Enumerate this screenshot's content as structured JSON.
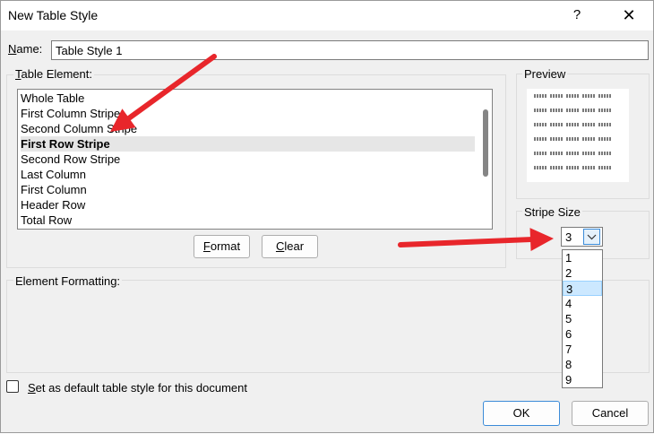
{
  "window": {
    "title": "New Table Style",
    "help": "?",
    "close": "✕"
  },
  "name": {
    "label": "Name:",
    "value": "Table Style 1"
  },
  "table_element": {
    "legend": "Table Element:",
    "items": [
      "Whole Table",
      "First Column Stripe",
      "Second Column Stripe",
      "First Row Stripe",
      "Second Row Stripe",
      "Last Column",
      "First Column",
      "Header Row",
      "Total Row"
    ],
    "selected_index": 3
  },
  "buttons": {
    "format": "Format",
    "clear": "Clear",
    "ok": "OK",
    "cancel": "Cancel"
  },
  "preview": {
    "legend": "Preview"
  },
  "stripe_size": {
    "legend": "Stripe Size",
    "value": "3",
    "options": [
      "1",
      "2",
      "3",
      "4",
      "5",
      "6",
      "7",
      "8",
      "9"
    ],
    "selected_index": 2
  },
  "element_formatting": {
    "legend": "Element Formatting:"
  },
  "default_checkbox": {
    "label": "Set as default table style for this document",
    "checked": false
  },
  "annotation": {
    "arrow_color": "#e8262b"
  }
}
